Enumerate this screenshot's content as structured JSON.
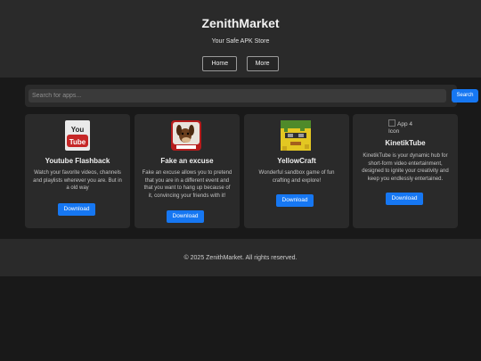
{
  "header": {
    "title": "ZenithMarket",
    "tagline": "Your Safe APK Store",
    "nav": [
      {
        "label": "Home"
      },
      {
        "label": "More"
      }
    ]
  },
  "search": {
    "placeholder": "Search for apps...",
    "button_label": "Search"
  },
  "apps": [
    {
      "title": "Youtube Flashback",
      "description": "Watch your favorite videos, channels and playlists wherever you are. But in a old way",
      "download_label": "Download",
      "icon": "youtube-icon"
    },
    {
      "title": "Fake an excuse",
      "description": "Fake an excuse allows you to pretend that you are in a different event and that you want to hang up because of it, convincing your friends with it!",
      "download_label": "Download",
      "icon": "dog-app-icon"
    },
    {
      "title": "YellowCraft",
      "description": "Wonderful sandbox game of fun crafting and explore!",
      "download_label": "Download",
      "icon": "pixel-block-face-icon"
    },
    {
      "title": "KinetikTube",
      "description": "KinetikTube is your dynamic hub for short-form video entertainment, designed to ignite your creativity and keep you endlessly entertained.",
      "download_label": "Download",
      "icon": "broken-image-icon",
      "icon_alt": "App 4 Icon"
    }
  ],
  "footer": {
    "text": "© 2025 ZenithMarket. All rights reserved."
  }
}
